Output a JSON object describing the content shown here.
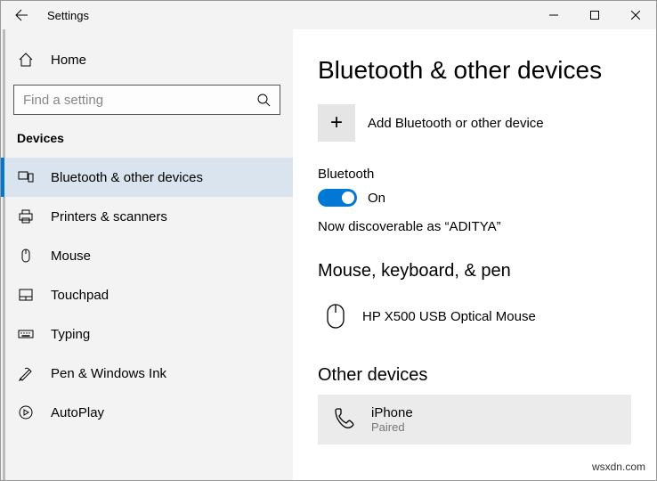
{
  "titlebar": {
    "title": "Settings"
  },
  "sidebar": {
    "home": "Home",
    "search_placeholder": "Find a setting",
    "category": "Devices",
    "items": [
      {
        "label": "Bluetooth & other devices"
      },
      {
        "label": "Printers & scanners"
      },
      {
        "label": "Mouse"
      },
      {
        "label": "Touchpad"
      },
      {
        "label": "Typing"
      },
      {
        "label": "Pen & Windows Ink"
      },
      {
        "label": "AutoPlay"
      }
    ]
  },
  "main": {
    "title": "Bluetooth & other devices",
    "add_device_label": "Add Bluetooth or other device",
    "bluetooth_section": "Bluetooth",
    "toggle_state": "On",
    "discoverable": "Now discoverable as “ADITYA”",
    "mouse_section": "Mouse, keyboard, & pen",
    "mouse_device": "HP X500 USB Optical Mouse",
    "other_section": "Other devices",
    "other_device": {
      "name": "iPhone",
      "status": "Paired"
    }
  },
  "watermark": "wsxdn.com"
}
